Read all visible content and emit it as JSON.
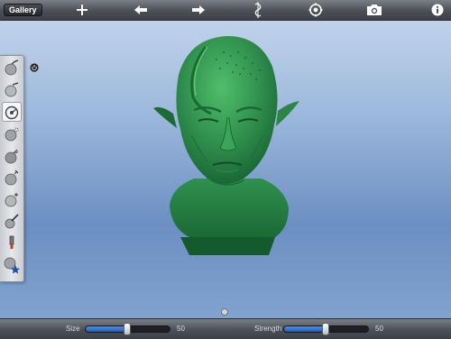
{
  "toolbar": {
    "gallery_label": "Gallery",
    "icons": [
      "add-icon",
      "undo-icon",
      "redo-icon",
      "symmetry-icon",
      "camera-reset-icon",
      "screenshot-camera-icon",
      "info-icon"
    ]
  },
  "tool_palette": {
    "tools": [
      "draw",
      "flatten",
      "grab",
      "smooth",
      "pinch",
      "inflate",
      "flatten-brush",
      "crease",
      "paint",
      "stamp"
    ],
    "selected": "grab"
  },
  "model": {
    "color": "#2d8a4a"
  },
  "bottom_bar": {
    "size_label": "Size",
    "size_value": "50",
    "size_fraction": 0.5,
    "strength_label": "Strength",
    "strength_value": "50",
    "strength_fraction": 0.5,
    "accent": "#2f6fd0"
  }
}
